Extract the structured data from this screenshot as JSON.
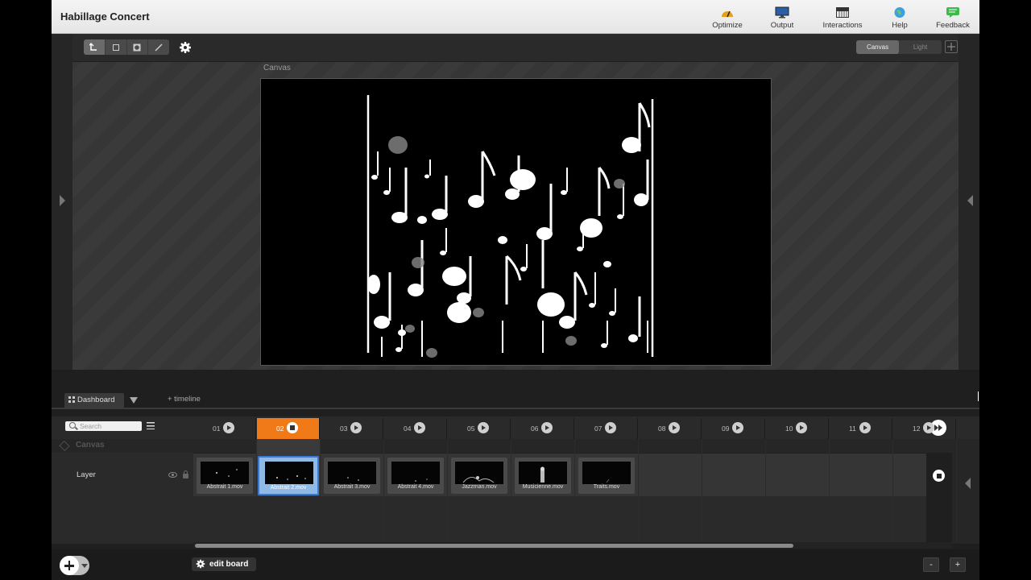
{
  "app": {
    "title": "Habillage Concert"
  },
  "titlebar_buttons": [
    {
      "label": "Optimize",
      "icon": "optimize-gauge-icon"
    },
    {
      "label": "Output",
      "icon": "monitor-icon"
    },
    {
      "label": "Interactions",
      "icon": "piano-keys-icon"
    },
    {
      "label": "Help",
      "icon": "globe-icon"
    },
    {
      "label": "Feedback",
      "icon": "speech-bubble-icon"
    }
  ],
  "toolbar": {
    "tools": [
      "select-arrow-icon",
      "crop-icon",
      "mask-icon",
      "brush-icon"
    ],
    "view_toggle": {
      "canvas": "Canvas",
      "light": "Light",
      "selected": "Canvas"
    }
  },
  "stage": {
    "canvas_label": "Canvas"
  },
  "dashboard": {
    "tab_label": "Dashboard",
    "add_timeline": "+ timeline"
  },
  "search": {
    "placeholder": "Search"
  },
  "cues": [
    {
      "num": "01"
    },
    {
      "num": "02",
      "active": true
    },
    {
      "num": "03"
    },
    {
      "num": "04"
    },
    {
      "num": "05"
    },
    {
      "num": "06"
    },
    {
      "num": "07"
    },
    {
      "num": "08"
    },
    {
      "num": "09"
    },
    {
      "num": "10"
    },
    {
      "num": "11"
    },
    {
      "num": "12"
    }
  ],
  "rows": {
    "canvas_label": "Canvas",
    "layer_label": "Layer"
  },
  "clips": [
    {
      "name": "Abstrait 1.mov"
    },
    {
      "name": "Abstrait 2.mov",
      "selected": true
    },
    {
      "name": "Abstrait 3.mov"
    },
    {
      "name": "Abstrait 4.mov"
    },
    {
      "name": "Jazzman.mov"
    },
    {
      "name": "Musicienne.mov"
    },
    {
      "name": "Traits.mov"
    }
  ],
  "bottom": {
    "edit_board": "edit board",
    "zoom_out": "-",
    "zoom_in": "+"
  },
  "colors": {
    "accent_orange": "#ef7a17",
    "selection_blue": "#3b78d4"
  }
}
